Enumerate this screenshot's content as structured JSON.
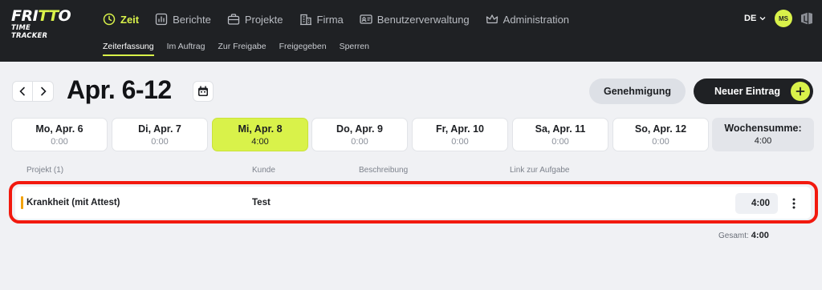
{
  "brand": {
    "line1_a": "FRI",
    "line1_b": "TT",
    "line1_c": "O",
    "line2": "TIME TRACKER",
    "accent_color": "#d9f24a"
  },
  "nav": {
    "items": [
      {
        "label": "Zeit",
        "icon": "clock-icon",
        "active": true
      },
      {
        "label": "Berichte",
        "icon": "chart-icon"
      },
      {
        "label": "Projekte",
        "icon": "briefcase-icon"
      },
      {
        "label": "Firma",
        "icon": "building-icon"
      },
      {
        "label": "Benutzerverwaltung",
        "icon": "id-card-icon"
      },
      {
        "label": "Administration",
        "icon": "crown-icon"
      }
    ],
    "sub": [
      "Zeiterfassung",
      "Im Auftrag",
      "Zur Freigabe",
      "Freigegeben",
      "Sperren"
    ],
    "language": "DE",
    "avatar_initials": "MS"
  },
  "week": {
    "title": "Apr. 6-12",
    "approve_label": "Genehmigung",
    "new_entry_label": "Neuer Eintrag",
    "days": [
      {
        "label": "Mo, Apr. 6",
        "value": "0:00"
      },
      {
        "label": "Di, Apr. 7",
        "value": "0:00"
      },
      {
        "label": "Mi, Apr. 8",
        "value": "4:00",
        "selected": true
      },
      {
        "label": "Do, Apr. 9",
        "value": "0:00"
      },
      {
        "label": "Fr, Apr. 10",
        "value": "0:00"
      },
      {
        "label": "Sa, Apr. 11",
        "value": "0:00"
      },
      {
        "label": "So, Apr. 12",
        "value": "0:00"
      }
    ],
    "sum_label": "Wochensumme:",
    "sum_value": "4:00"
  },
  "table": {
    "headers": [
      "Projekt (1)",
      "Kunde",
      "Beschreibung",
      "Link zur Aufgabe"
    ],
    "rows": [
      {
        "project": "Krankheit (mit Attest)",
        "customer": "Test",
        "description": "",
        "link": "",
        "duration": "4:00",
        "project_color": "#f2a20d"
      }
    ],
    "total_label": "Gesamt:",
    "total_value": "4:00"
  },
  "highlight_color": "#f2190e"
}
